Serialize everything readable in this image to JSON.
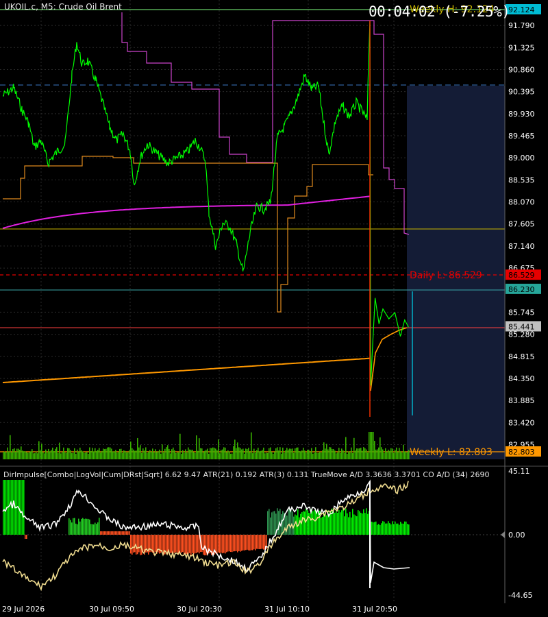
{
  "header": {
    "symbol_line": "UKOIL.c, M5:  Crude Oil Brent",
    "timer": "00:04:02 (-7.25%)"
  },
  "price_axis": {
    "ticks": [
      "91.790",
      "91.325",
      "90.860",
      "90.395",
      "89.930",
      "89.465",
      "89.000",
      "88.535",
      "88.070",
      "87.605",
      "87.140",
      "86.675",
      "85.745",
      "85.280",
      "84.815",
      "84.350",
      "83.885",
      "83.420",
      "82.955"
    ]
  },
  "price_tags": [
    {
      "label": "92.124",
      "value": 92.124,
      "bg": "#00bcd4",
      "fg": "#000000"
    },
    {
      "label": "86.529",
      "value": 86.529,
      "bg": "#e60000",
      "fg": "#000000"
    },
    {
      "label": "86.230",
      "value": 86.23,
      "bg": "#26a69a",
      "fg": "#000000"
    },
    {
      "label": "85.441",
      "value": 85.441,
      "bg": "#c0c0c0",
      "fg": "#000000"
    },
    {
      "label": "82.803",
      "value": 82.803,
      "bg": "#ff9800",
      "fg": "#000000"
    }
  ],
  "overlay_labels": {
    "weekly_high": "Weekly H: 92.124",
    "daily_low": "Daily L: 86.529",
    "weekly_low": "Weekly L: 82.803"
  },
  "indicator": {
    "header": "DirImpulse[Combo|LogVol|Cum|DRst|Sqrt] 6.62 9.47 ATR(21) 0.192 ATR(3) 0.131 TrueMove A/D 3.3636 3.3701 CO A/D (34) 2690",
    "ticks": [
      "45.11",
      "0.00",
      "-44.65"
    ]
  },
  "time_axis": {
    "labels": [
      "29 Jul 2026",
      "30 Jul 09:50",
      "30 Jul 20:30",
      "31 Jul 10:10",
      "31 Jul 20:50"
    ]
  },
  "colors": {
    "price_line": "#00ff00",
    "down_line": "#ff3300",
    "magenta": "#ff00ff",
    "orange": "#ff9800",
    "orchid": "#cc44cc",
    "volume": "#38b000",
    "axis_text": "#ffffff",
    "future_zone": "#141c36"
  }
}
